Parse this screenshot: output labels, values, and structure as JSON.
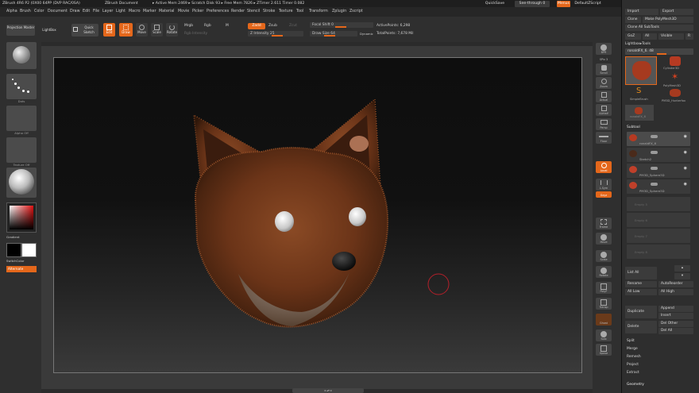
{
  "titlebar": {
    "app_title": "ZBrush 4R6 P2 (0X00 64PP (DVP RAC/0SA)",
    "document": "ZBrush Document",
    "stats": "▸ Active Mem 2469 ▸ Scratch Disk 93 ▸ Free Mem 7826 ▸ ZTimer 2.611 Timer 0.082"
  },
  "top_buttons": {
    "quicksave": "QuickSave",
    "seethrough": "See-through",
    "seethrough_value": "0",
    "menus": "Menus",
    "defaultzscript": "DefaultZScript"
  },
  "menus": [
    "Alpha",
    "Brush",
    "Color",
    "Document",
    "Draw",
    "Edit",
    "File",
    "Layer",
    "Light",
    "Macro",
    "Marker",
    "Material",
    "Movie",
    "Picker",
    "Preferences",
    "Render",
    "Stencil",
    "Stroke",
    "Texture",
    "Tool",
    "Transform",
    "Zplugin",
    "Zscript"
  ],
  "toolbar": {
    "projection_master": "Projection Master",
    "lightbox": "LightBox",
    "quick_sketch": "Quick Sketch",
    "edit": "Edit",
    "draw": "Draw",
    "move": "Move",
    "scale": "Scale",
    "rotate": "Rotate",
    "mrgb": "Mrgb",
    "rgb": "Rgb",
    "m": "M",
    "rgb_intensity": "Rgb Intensity",
    "zadd": "Zadd",
    "zsub": "Zsub",
    "zcut": "Zcut",
    "z_intensity": "Z Intensity 25",
    "focal_shift": "Focal Shift 0",
    "draw_size": "Draw Size 64",
    "dynamic": "Dynamic",
    "active_points": "ActivePoints: 6,298",
    "total_points": "TotalPoints: 7,678 Mil"
  },
  "left_shelf": {
    "labels": [
      "",
      "Dots",
      "Alpha Off",
      "Texture Off",
      "",
      "Gradient",
      "SwitchColor",
      "Alternate"
    ]
  },
  "right_shelf": {
    "buttons": [
      "BPR",
      "SPix 3",
      "Scroll",
      "Zoom",
      "Actual",
      "AAHalf",
      "Persp",
      "Floor",
      "Local",
      "L.Sym",
      "Gxyz",
      "Frame",
      "Move",
      "Scale",
      "Rotate",
      "PolyF",
      "Transp",
      "Ghost",
      "Solo",
      "Xpose"
    ]
  },
  "panel": {
    "import": "Import",
    "export": "Export",
    "clone": "Clone",
    "make_polymesh": "Make PolyMesh3D",
    "clone_all_subtools": "Clone All SubTools",
    "goz": "GoZ",
    "all": "All",
    "visible": "Visible",
    "r": "R",
    "lightbox_tools": "Lightbox▸Tools",
    "current_tool": "ronaldFX_6. 48",
    "tool_names": [
      "",
      "Cylinder3D",
      "PolyMesh3D",
      "SimpleBrush",
      "PM3D_Hunterfox",
      "ronaldFX_6"
    ],
    "subtool_header": "Subtool",
    "subtools": [
      "ronaldFX_6",
      "Sketch2",
      "PM3D_Sphere3D",
      "PM3D_Sphere3D"
    ],
    "hidden_slots": [
      "Empty 5",
      "Empty 6",
      "Empty 7",
      "Empty 8"
    ],
    "list_all": "List All",
    "rename": "Rename",
    "autoreorder": "AutoReorder",
    "all_low": "All Low",
    "all_high": "All High",
    "duplicate": "Duplicate",
    "append": "Append",
    "insert": "Insert",
    "delete": "Delete",
    "del_other": "Del Other",
    "del_all": "Del All",
    "split": "Split",
    "merge": "Merge",
    "remesh": "Remesh",
    "project": "Project",
    "extract": "Extract",
    "geometry": "Geometry"
  },
  "status": {
    "bottom": "◂  ▴▾  ▸"
  },
  "colors": {
    "accent": "#e4671b",
    "canvas_frame": "#3a3a3a",
    "cursor_ring": "#b3202a"
  }
}
